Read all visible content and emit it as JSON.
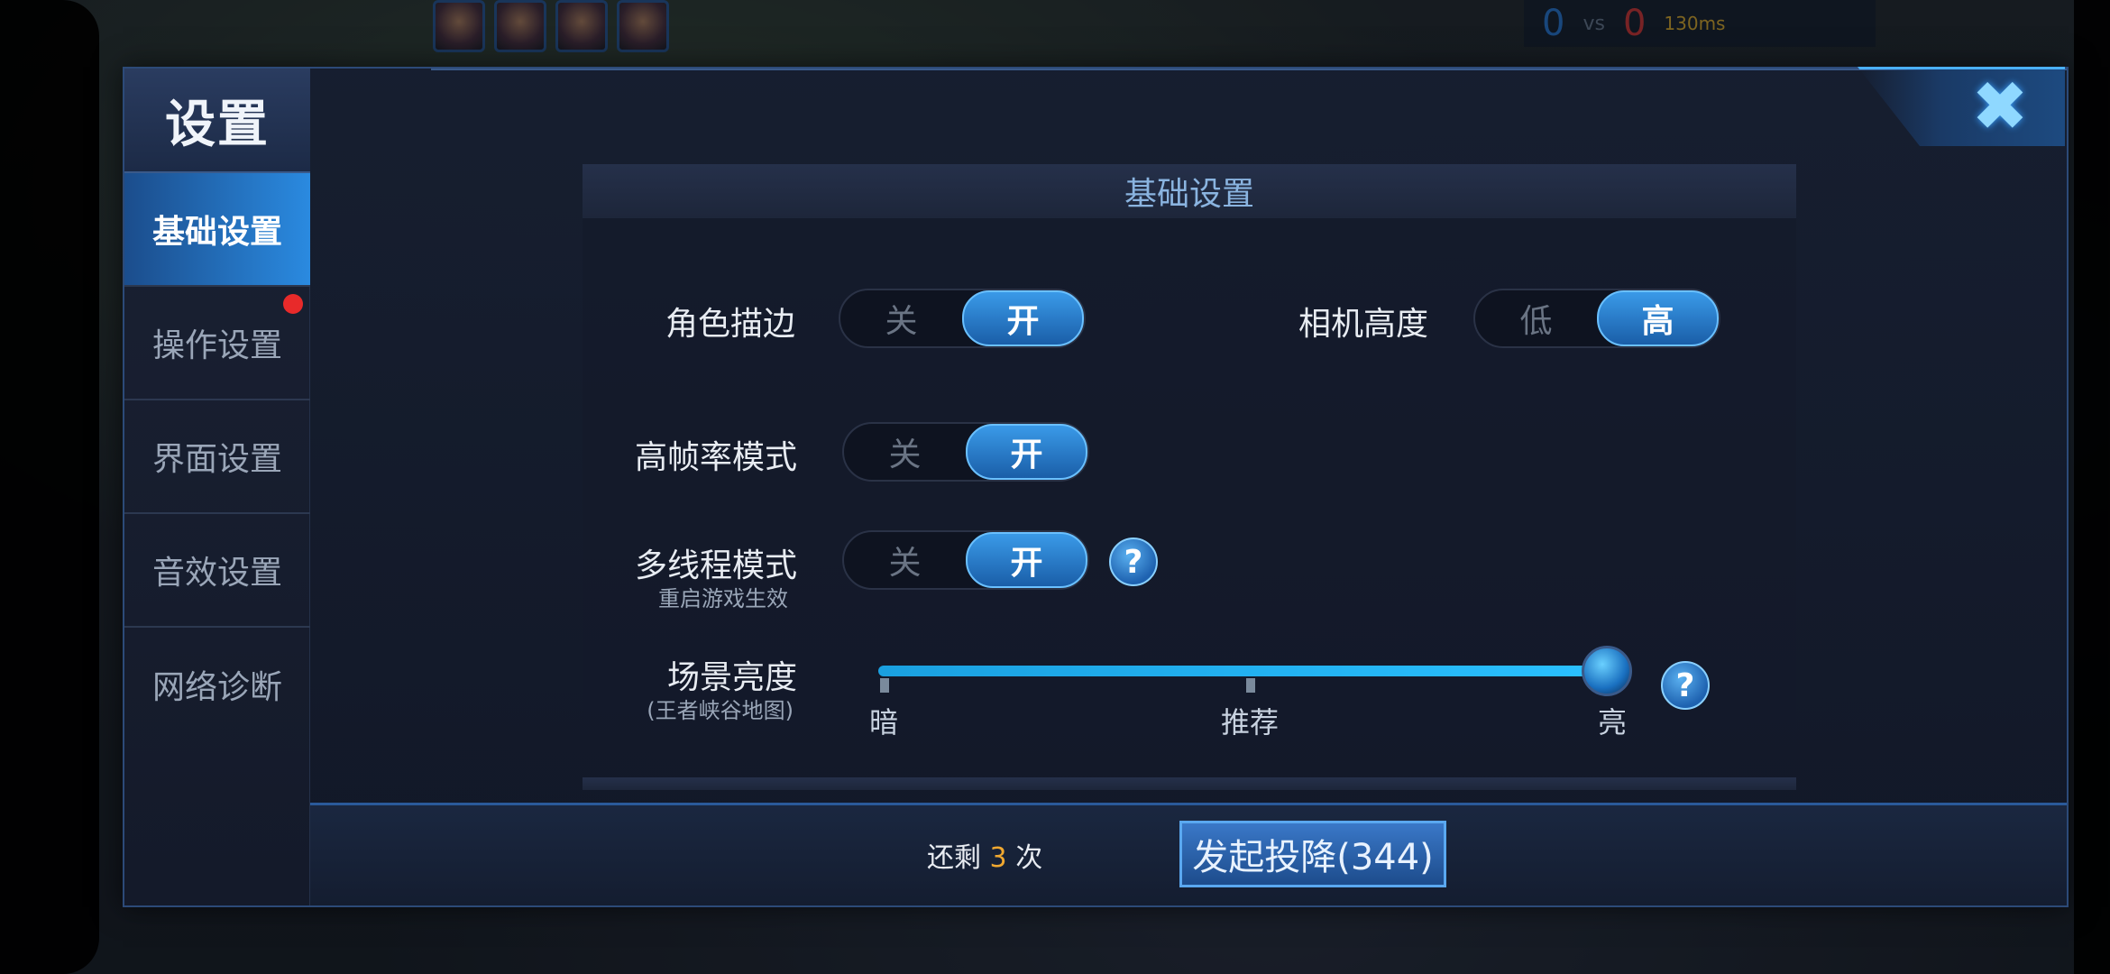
{
  "dialog": {
    "title": "设置",
    "close_icon": "close-x-icon"
  },
  "sidebar": {
    "items": [
      {
        "label": "基础设置",
        "active": true,
        "badge": false
      },
      {
        "label": "操作设置",
        "active": false,
        "badge": true
      },
      {
        "label": "界面设置",
        "active": false,
        "badge": false
      },
      {
        "label": "音效设置",
        "active": false,
        "badge": false
      },
      {
        "label": "网络诊断",
        "active": false,
        "badge": false
      }
    ]
  },
  "section": {
    "title": "基础设置"
  },
  "settings": {
    "outline": {
      "label": "角色描边",
      "off": "关",
      "on": "开",
      "value": "开"
    },
    "camera": {
      "label": "相机高度",
      "off": "低",
      "on": "高",
      "value": "高"
    },
    "high_fps": {
      "label": "高帧率模式",
      "off": "关",
      "on": "开",
      "value": "开"
    },
    "multithread": {
      "label": "多线程模式",
      "sub": "重启游戏生效",
      "off": "关",
      "on": "开",
      "value": "开",
      "help": "?"
    },
    "brightness": {
      "label": "场景亮度",
      "sub": "(王者峡谷地图)",
      "min_label": "暗",
      "mid_label": "推荐",
      "max_label": "亮",
      "value": 1.0,
      "help": "?"
    }
  },
  "footer": {
    "remain_prefix": "还剩",
    "remain_count": "3",
    "remain_suffix": "次",
    "surrender_label": "发起投降(344)"
  },
  "game_hud": {
    "score_blue": "0",
    "score_vs": "vs",
    "score_red": "0",
    "ping": "130ms"
  },
  "colors": {
    "accent": "#2a8ae0",
    "badge": "#e82a2a",
    "count_highlight": "#f0a830"
  }
}
